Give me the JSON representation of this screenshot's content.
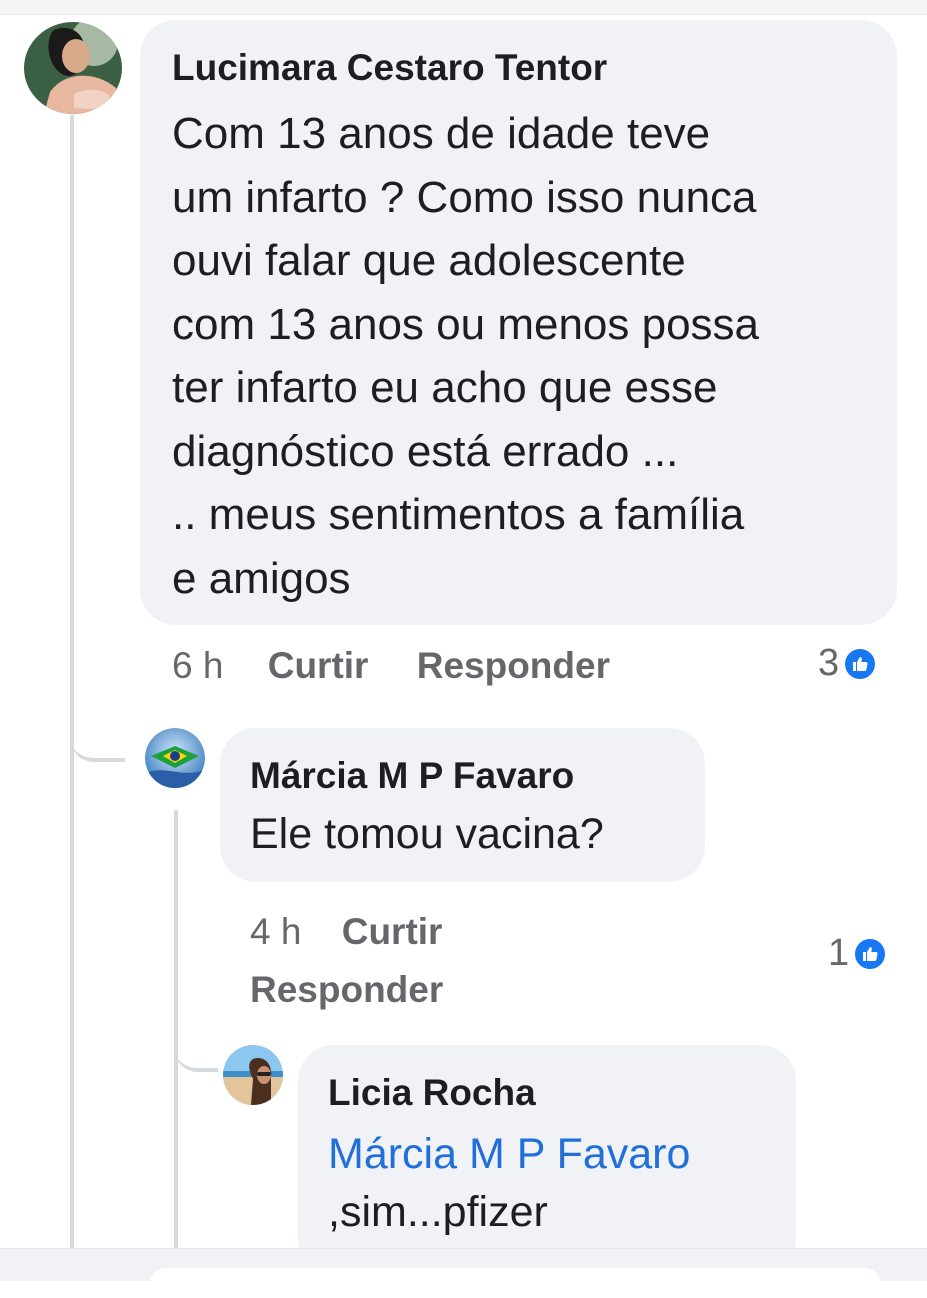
{
  "comments": [
    {
      "author": "Lucimara Cestaro Tentor",
      "text": "Com 13 anos de idade teve\num infarto ? Como isso nunca\nouvi falar que adolescente\ncom 13 anos ou menos possa\nter infarto eu acho que esse\ndiagnóstico está errado ...\n.. meus sentimentos a família\ne amigos",
      "time": "6 h",
      "like_label": "Curtir",
      "reply_label": "Responder",
      "reaction_count": "3",
      "reaction_icon": "like-icon"
    },
    {
      "author": "Márcia M P Favaro",
      "text": "Ele tomou vacina?",
      "time": "4 h",
      "like_label": "Curtir",
      "reply_label": "Responder",
      "reaction_count": "1",
      "reaction_icon": "like-icon"
    },
    {
      "author": "Licia Rocha",
      "mention": "Márcia M P Favaro",
      "text": ",sim...pfizer"
    }
  ],
  "colors": {
    "bubble": "#f0f2f5",
    "mention": "#216fdb",
    "meta": "#65676b",
    "like": "#1877f2"
  }
}
